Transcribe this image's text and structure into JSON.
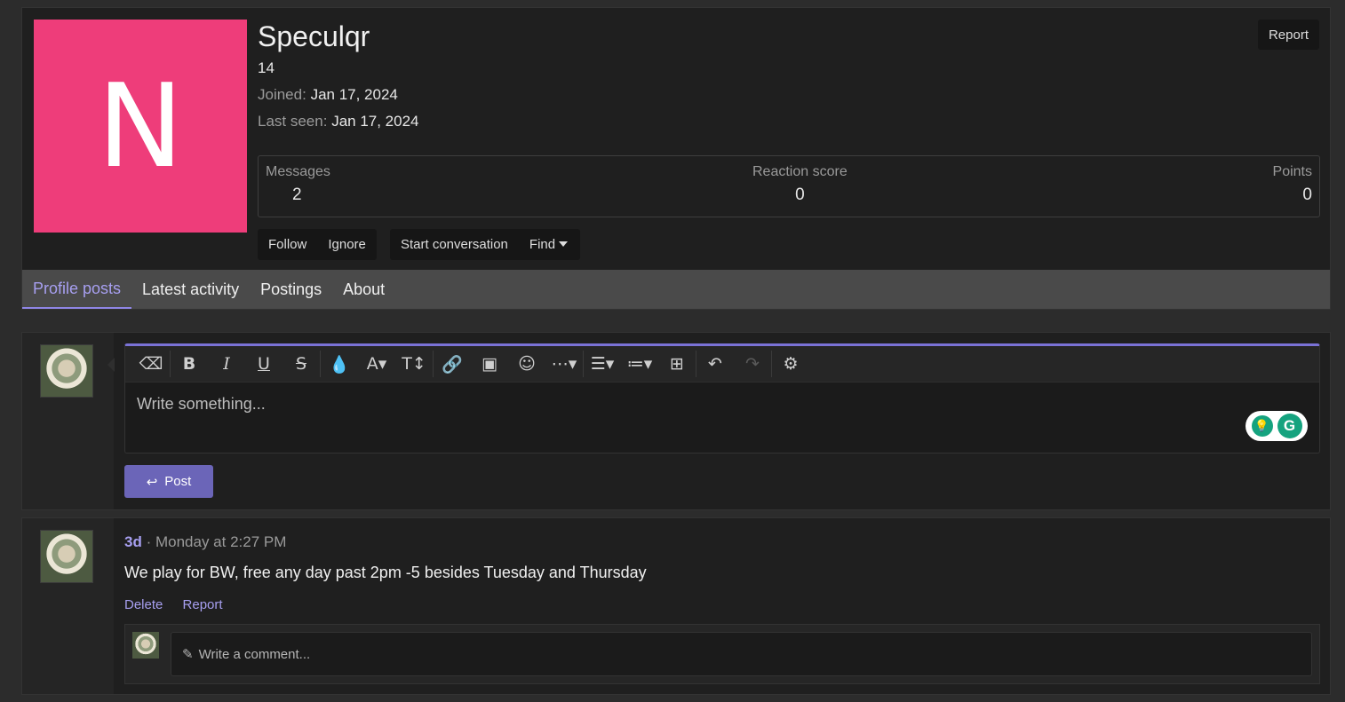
{
  "profile": {
    "avatar_letter": "N",
    "avatar_color": "#ee3d7a",
    "username": "Speculqr",
    "title": "14",
    "joined_label": "Joined:",
    "joined_value": "Jan 17, 2024",
    "last_seen_label": "Last seen:",
    "last_seen_value": "Jan 17, 2024",
    "report_label": "Report"
  },
  "stats": {
    "messages_label": "Messages",
    "messages_value": "2",
    "reaction_label": "Reaction score",
    "reaction_value": "0",
    "points_label": "Points",
    "points_value": "0"
  },
  "actions": {
    "follow": "Follow",
    "ignore": "Ignore",
    "start_conversation": "Start conversation",
    "find": "Find"
  },
  "tabs": [
    "Profile posts",
    "Latest activity",
    "Postings",
    "About"
  ],
  "editor": {
    "placeholder": "Write something...",
    "post_button": "Post",
    "toolbar_icons": [
      "eraser-icon",
      "bold-icon",
      "italic-icon",
      "underline-icon",
      "strikethrough-icon",
      "text-color-icon",
      "font-family-icon",
      "font-size-icon",
      "link-icon",
      "image-icon",
      "emoji-icon",
      "more-icon",
      "align-icon",
      "list-icon",
      "table-icon",
      "undo-icon",
      "redo-icon",
      "settings-icon"
    ]
  },
  "post": {
    "author": "3d",
    "timestamp": "Monday at 2:27 PM",
    "text": "We play for BW, free any day past 2pm -5 besides Tuesday and Thursday",
    "delete_label": "Delete",
    "report_label": "Report",
    "comment_placeholder": "Write a comment..."
  },
  "colors": {
    "accent": "#7a72d6",
    "post_button": "#6b65b8",
    "grammarly": "#15a37f"
  }
}
